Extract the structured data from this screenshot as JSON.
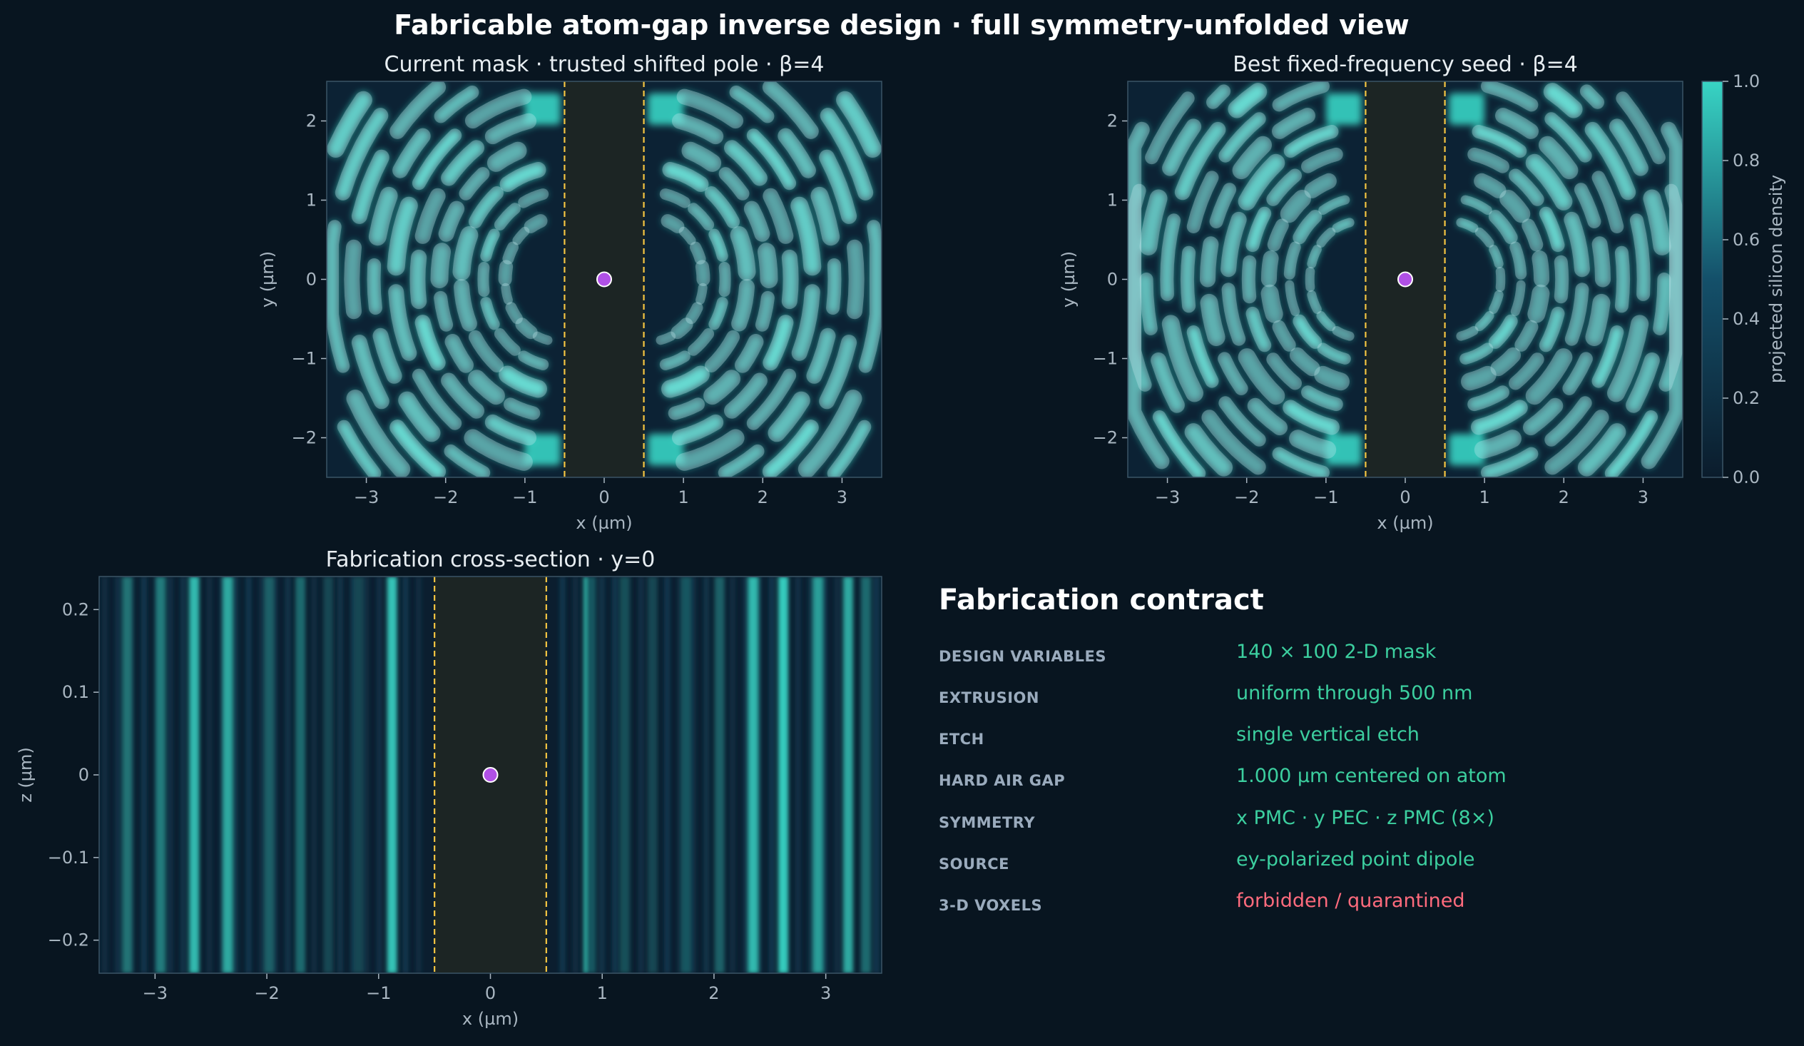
{
  "figure_title": "Fabricable atom-gap inverse design · full symmetry-unfolded view",
  "chart_data": [
    {
      "type": "heatmap",
      "id": "mask_current",
      "title": "Current mask · trusted shifted pole · β=4",
      "xlabel": "x (µm)",
      "ylabel": "y (µm)",
      "xlim": [
        -3.5,
        3.5
      ],
      "ylim": [
        -2.5,
        2.5
      ],
      "xticks": [
        -3,
        -2,
        -1,
        0,
        1,
        2,
        3
      ],
      "yticks": [
        -2,
        -1,
        0,
        1,
        2
      ],
      "air_gap": [
        -0.5,
        0.5
      ],
      "atom": [
        0,
        0
      ],
      "variant": 0
    },
    {
      "type": "heatmap",
      "id": "mask_seed",
      "title": "Best fixed-frequency seed · β=4",
      "xlabel": "x (µm)",
      "ylabel": "y (µm)",
      "xlim": [
        -3.5,
        3.5
      ],
      "ylim": [
        -2.5,
        2.5
      ],
      "xticks": [
        -3,
        -2,
        -1,
        0,
        1,
        2,
        3
      ],
      "yticks": [
        -2,
        -1,
        0,
        1,
        2
      ],
      "air_gap": [
        -0.5,
        0.5
      ],
      "atom": [
        0,
        0
      ],
      "variant": 1
    },
    {
      "type": "heatmap",
      "id": "cross_section",
      "title": "Fabrication cross-section · y=0",
      "xlabel": "x (µm)",
      "ylabel": "z (µm)",
      "xlim": [
        -3.5,
        3.5
      ],
      "ylim": [
        -0.24,
        0.24
      ],
      "xticks": [
        -3,
        -2,
        -1,
        0,
        1,
        2,
        3
      ],
      "yticks": [
        0.2,
        0.1,
        0.0,
        -0.1,
        -0.2
      ],
      "air_gap": [
        -0.5,
        0.5
      ],
      "atom": [
        0,
        0
      ],
      "stripes": [
        {
          "x": 0.88,
          "d": 1.0
        },
        {
          "x": 0.9,
          "d": 0.3
        },
        {
          "x": 1.2,
          "d": 0.25
        },
        {
          "x": 1.45,
          "d": 0.2
        },
        {
          "x": 1.75,
          "d": 0.3
        },
        {
          "x": 1.75,
          "d": 0.3
        },
        {
          "x": 2.05,
          "d": 0.35
        },
        {
          "x": 2.35,
          "d": 0.85
        },
        {
          "x": 2.62,
          "d": 0.95
        },
        {
          "x": 2.93,
          "d": 0.7
        },
        {
          "x": 3.2,
          "d": 0.75
        },
        {
          "x": 3.36,
          "d": 0.4
        }
      ],
      "stripes_left": [
        {
          "x": -0.88,
          "d": 0.9
        },
        {
          "x": -1.18,
          "d": 0.2
        },
        {
          "x": -1.45,
          "d": 0.2
        },
        {
          "x": -1.7,
          "d": 0.4
        },
        {
          "x": -1.98,
          "d": 0.35
        },
        {
          "x": -2.35,
          "d": 0.75
        },
        {
          "x": -2.65,
          "d": 0.85
        },
        {
          "x": -2.95,
          "d": 0.5
        },
        {
          "x": -3.25,
          "d": 0.45
        }
      ]
    }
  ],
  "colorbar": {
    "label": "projected silicon density",
    "range": [
      0.0,
      1.0
    ],
    "ticks": [
      "0.0",
      "0.2",
      "0.4",
      "0.6",
      "0.8",
      "1.0"
    ],
    "color_low": "#0c2235",
    "color_high": "#38d4c4"
  },
  "colors": {
    "background": "#081520",
    "gap_fill": "#1c2524",
    "gap_line": "#f5c542",
    "atom": "#b050e6",
    "axis": "#3a5566",
    "text": "#e8eef2",
    "tick_text": "#a9b6c1"
  },
  "contract": {
    "title": "Fabrication contract",
    "rows": [
      {
        "key": "DESIGN VARIABLES",
        "value": "140 × 100 2-D mask"
      },
      {
        "key": "EXTRUSION",
        "value": "uniform through 500 nm"
      },
      {
        "key": "ETCH",
        "value": "single vertical etch"
      },
      {
        "key": "HARD AIR GAP",
        "value": "1.000 µm centered on atom"
      },
      {
        "key": "SYMMETRY",
        "value": "x PMC · y PEC · z PMC (8×)"
      },
      {
        "key": "SOURCE",
        "value": "ey-polarized point dipole"
      },
      {
        "key": "3-D VOXELS",
        "value": "forbidden / quarantined"
      }
    ]
  }
}
